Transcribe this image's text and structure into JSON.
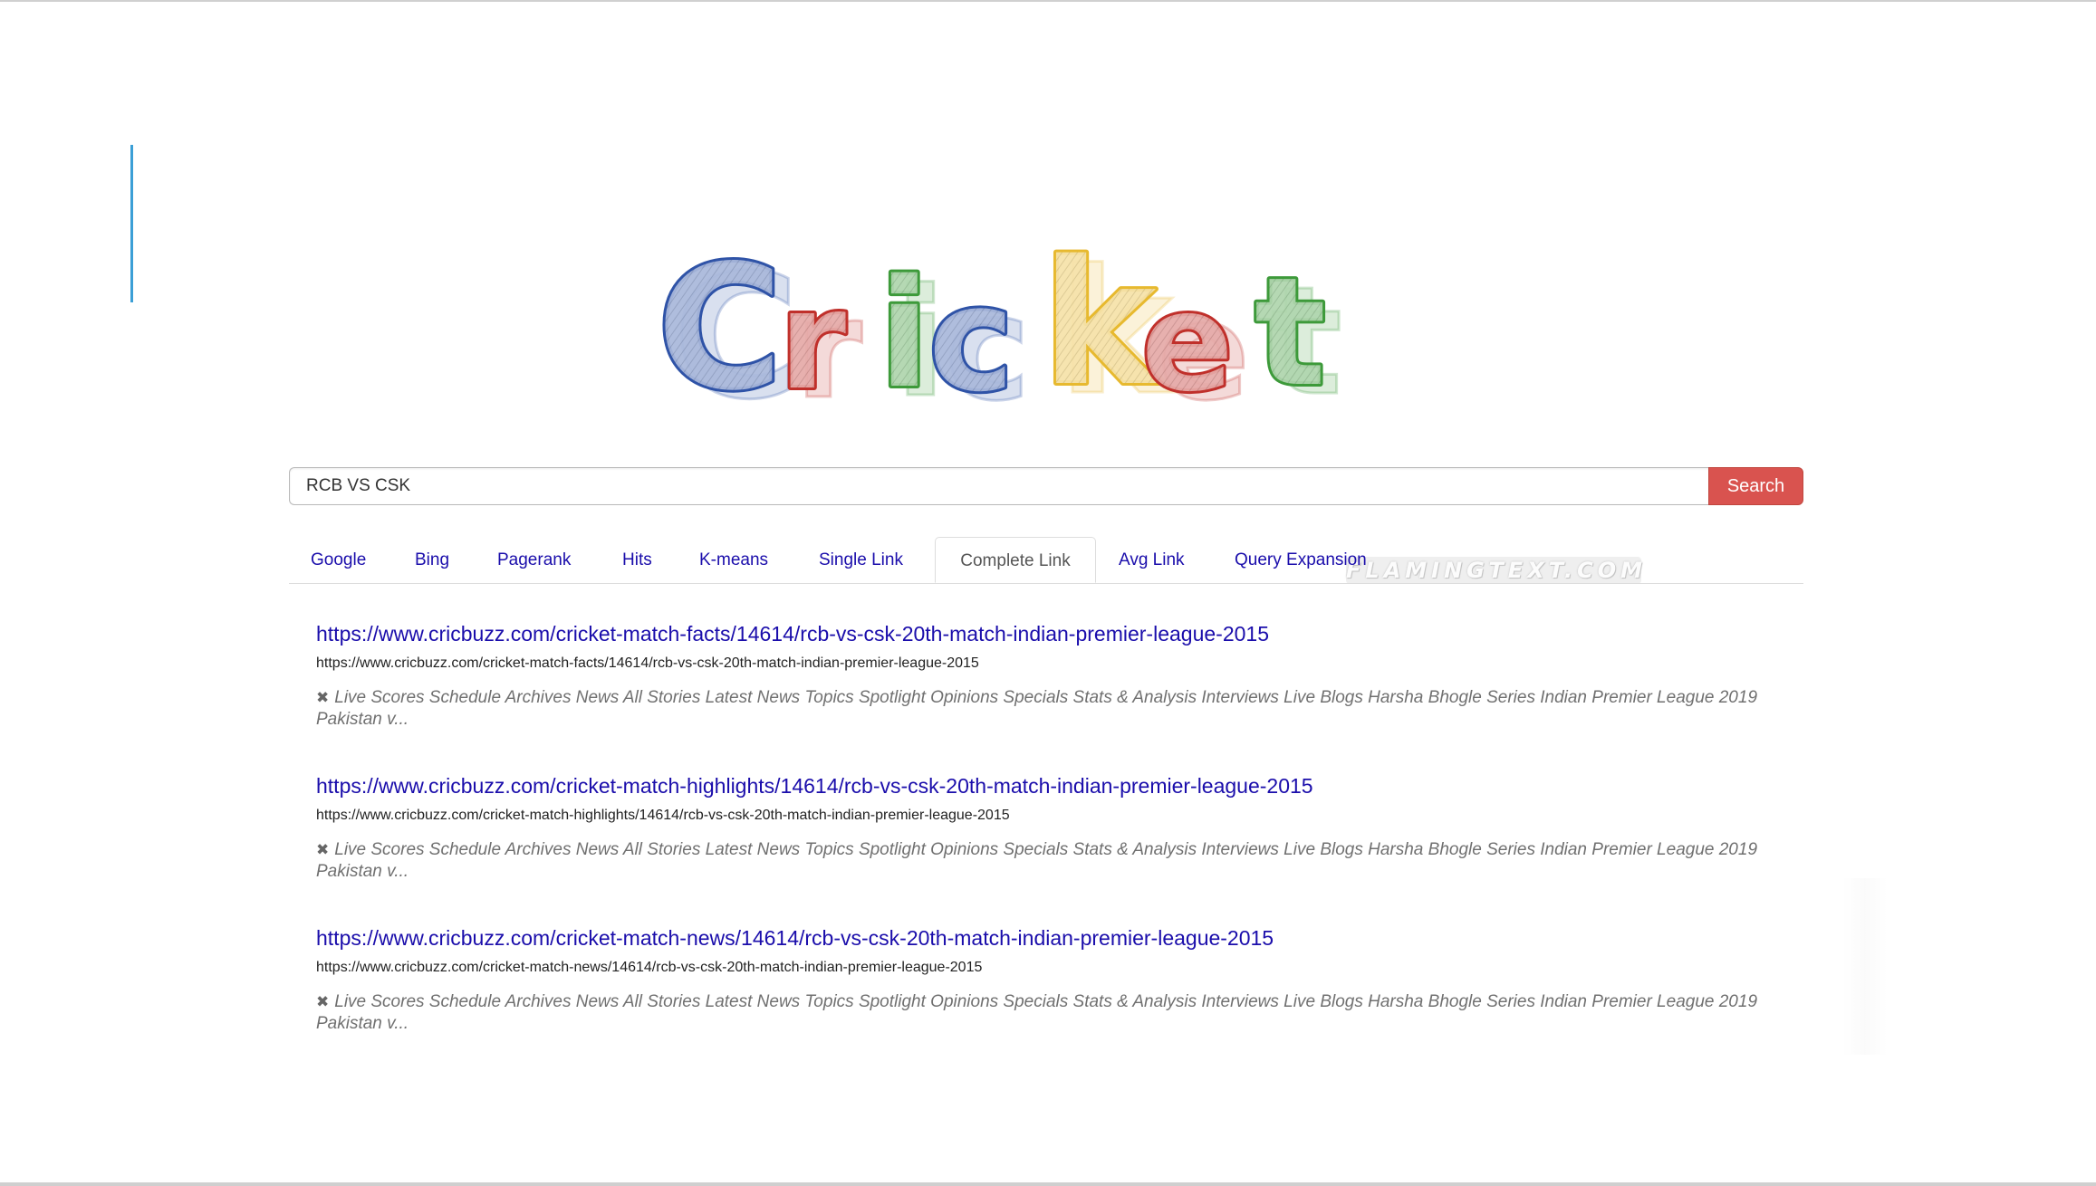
{
  "logo": {
    "text": "Cricket",
    "letters": [
      {
        "char": "C",
        "color": "#2f53a7"
      },
      {
        "char": "r",
        "color": "#c0302b"
      },
      {
        "char": "i",
        "color": "#3d9a3a"
      },
      {
        "char": "c",
        "color": "#2f53a7"
      },
      {
        "char": "k",
        "color": "#e7b92f"
      },
      {
        "char": "e",
        "color": "#c0302b"
      },
      {
        "char": "t",
        "color": "#3d9a3a"
      }
    ],
    "watermark": "FLAMINGTEXT.COM"
  },
  "search": {
    "value": "RCB VS CSK",
    "button_label": "Search"
  },
  "tabs": [
    {
      "label": "Google",
      "active": false
    },
    {
      "label": "Bing",
      "active": false
    },
    {
      "label": "Pagerank",
      "active": false
    },
    {
      "label": "Hits",
      "active": false
    },
    {
      "label": "K-means",
      "active": false
    },
    {
      "label": "Single Link",
      "active": false
    },
    {
      "label": "Complete Link",
      "active": true
    },
    {
      "label": "Avg Link",
      "active": false
    },
    {
      "label": "Query Expansion",
      "active": false
    }
  ],
  "results": [
    {
      "title": "https://www.cricbuzz.com/cricket-match-facts/14614/rcb-vs-csk-20th-match-indian-premier-league-2015",
      "url": "https://www.cricbuzz.com/cricket-match-facts/14614/rcb-vs-csk-20th-match-indian-premier-league-2015",
      "snippet_icon": "✖",
      "snippet": "Live Scores Schedule Archives News All Stories Latest News Topics Spotlight Opinions Specials Stats & Analysis Interviews Live Blogs Harsha Bhogle Series Indian Premier League 2019 Pakistan v..."
    },
    {
      "title": "https://www.cricbuzz.com/cricket-match-highlights/14614/rcb-vs-csk-20th-match-indian-premier-league-2015",
      "url": "https://www.cricbuzz.com/cricket-match-highlights/14614/rcb-vs-csk-20th-match-indian-premier-league-2015",
      "snippet_icon": "✖",
      "snippet": "Live Scores Schedule Archives News All Stories Latest News Topics Spotlight Opinions Specials Stats & Analysis Interviews Live Blogs Harsha Bhogle Series Indian Premier League 2019 Pakistan v..."
    },
    {
      "title": "https://www.cricbuzz.com/cricket-match-news/14614/rcb-vs-csk-20th-match-indian-premier-league-2015",
      "url": "https://www.cricbuzz.com/cricket-match-news/14614/rcb-vs-csk-20th-match-indian-premier-league-2015",
      "snippet_icon": "✖",
      "snippet": "Live Scores Schedule Archives News All Stories Latest News Topics Spotlight Opinions Specials Stats & Analysis Interviews Live Blogs Harsha Bhogle Series Indian Premier League 2019 Pakistan v..."
    }
  ],
  "colors": {
    "link": "#1a0dab",
    "search_button": "#d9534f",
    "accent_bar": "#3b9fd6",
    "snippet": "#707070"
  }
}
